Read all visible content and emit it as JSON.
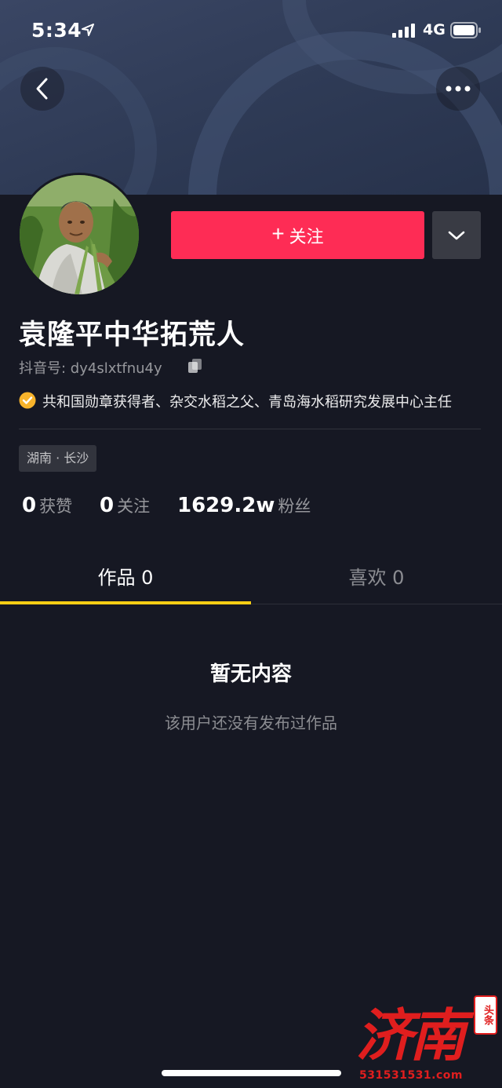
{
  "status_bar": {
    "time": "5:34",
    "network": "4G",
    "icons": [
      "location-arrow-icon",
      "signal-icon",
      "battery-icon"
    ]
  },
  "header": {
    "back_icon": "chevron-left-icon",
    "more_icon": "more-dots-icon"
  },
  "profile": {
    "name": "袁隆平中华拓荒人",
    "douyin_id": "抖音号: dy4slxtfnu4y",
    "verification": "共和国勋章获得者、杂交水稻之父、青岛海水稻研究发展中心主任",
    "location_tag": "湖南 · 长沙"
  },
  "actions": {
    "follow_plus": "+",
    "follow_label": "关注",
    "dropdown_icon": "chevron-down-icon"
  },
  "stats": {
    "likes_count": "0",
    "likes_label": "获赞",
    "following_count": "0",
    "following_label": "关注",
    "followers_count": "1629.2w",
    "followers_label": "粉丝"
  },
  "tabs": {
    "works": "作品 0",
    "likes": "喜欢 0",
    "active": "works"
  },
  "empty_state": {
    "title": "暂无内容",
    "subtitle": "该用户还没有发布过作品"
  },
  "watermark": {
    "main": "济南",
    "stamp": "头条",
    "url": "531531531.com"
  },
  "colors": {
    "background": "#161823",
    "follow_button": "#fe2c55",
    "tab_indicator": "#face15",
    "verify_badge": "#f7b32b",
    "watermark": "#e01e1e"
  }
}
